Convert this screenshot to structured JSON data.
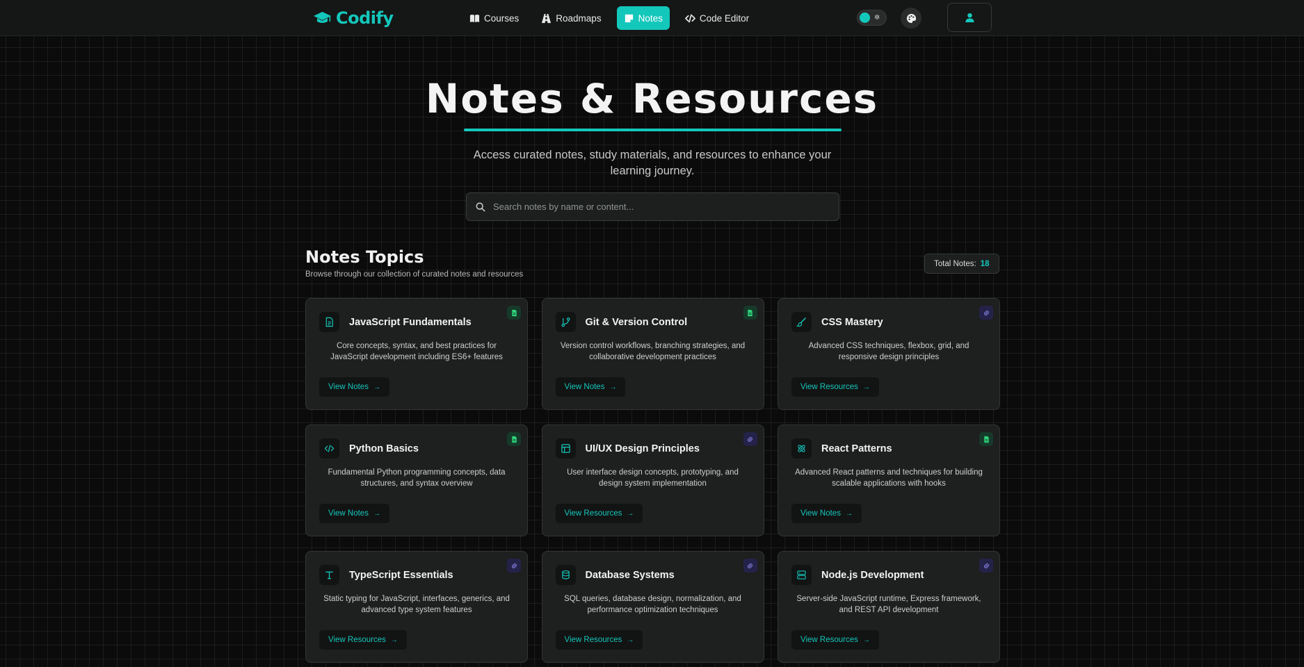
{
  "brand": {
    "name": "Codify",
    "icon": "graduation-cap-icon",
    "color": "#14c7bb"
  },
  "nav": {
    "items": [
      {
        "label": "Courses",
        "icon": "book-icon",
        "active": false
      },
      {
        "label": "Roadmaps",
        "icon": "route-icon",
        "active": false
      },
      {
        "label": "Notes",
        "icon": "sticky-note-icon",
        "active": true
      },
      {
        "label": "Code Editor",
        "icon": "code-icon",
        "active": false
      }
    ],
    "theme_toggle": {
      "icon": "sun-icon"
    },
    "palette_icon": "palette-icon",
    "user_icon": "user-icon"
  },
  "hero": {
    "title": "Notes & Resources",
    "subtitle": "Access curated notes, study materials, and resources to enhance your learning journey."
  },
  "search": {
    "placeholder": "Search notes by name or content...",
    "value": "",
    "icon": "search-icon"
  },
  "topics": {
    "title": "Notes Topics",
    "subtitle": "Browse through our collection of curated notes and resources",
    "total_label": "Total Notes:",
    "total_count": "18"
  },
  "cards": [
    {
      "title": "JavaScript Fundamentals",
      "desc": "Core concepts, syntax, and best practices for JavaScript development including ES6+ features",
      "button": "View Notes",
      "icon": "file-text-icon",
      "tag": "notes"
    },
    {
      "title": "Git & Version Control",
      "desc": "Version control workflows, branching strategies, and collaborative development practices",
      "button": "View Notes",
      "icon": "git-branch-icon",
      "tag": "notes"
    },
    {
      "title": "CSS Mastery",
      "desc": "Advanced CSS techniques, flexbox, grid, and responsive design principles",
      "button": "View Resources",
      "icon": "paintbrush-icon",
      "tag": "link"
    },
    {
      "title": "Python Basics",
      "desc": "Fundamental Python programming concepts, data structures, and syntax overview",
      "button": "View Notes",
      "icon": "code-icon",
      "tag": "notes"
    },
    {
      "title": "UI/UX Design Principles",
      "desc": "User interface design concepts, prototyping, and design system implementation",
      "button": "View Resources",
      "icon": "layout-icon",
      "tag": "link"
    },
    {
      "title": "React Patterns",
      "desc": "Advanced React patterns and techniques for building scalable applications with hooks",
      "button": "View Notes",
      "icon": "atom-icon",
      "tag": "notes"
    },
    {
      "title": "TypeScript Essentials",
      "desc": "Static typing for JavaScript, interfaces, generics, and advanced type system features",
      "button": "View Resources",
      "icon": "type-icon",
      "tag": "link"
    },
    {
      "title": "Database Systems",
      "desc": "SQL queries, database design, normalization, and performance optimization techniques",
      "button": "View Resources",
      "icon": "database-icon",
      "tag": "link"
    },
    {
      "title": "Node.js Development",
      "desc": "Server-side JavaScript runtime, Express framework, and REST API development",
      "button": "View Resources",
      "icon": "server-icon",
      "tag": "link"
    }
  ],
  "arrow_glyph": "→"
}
